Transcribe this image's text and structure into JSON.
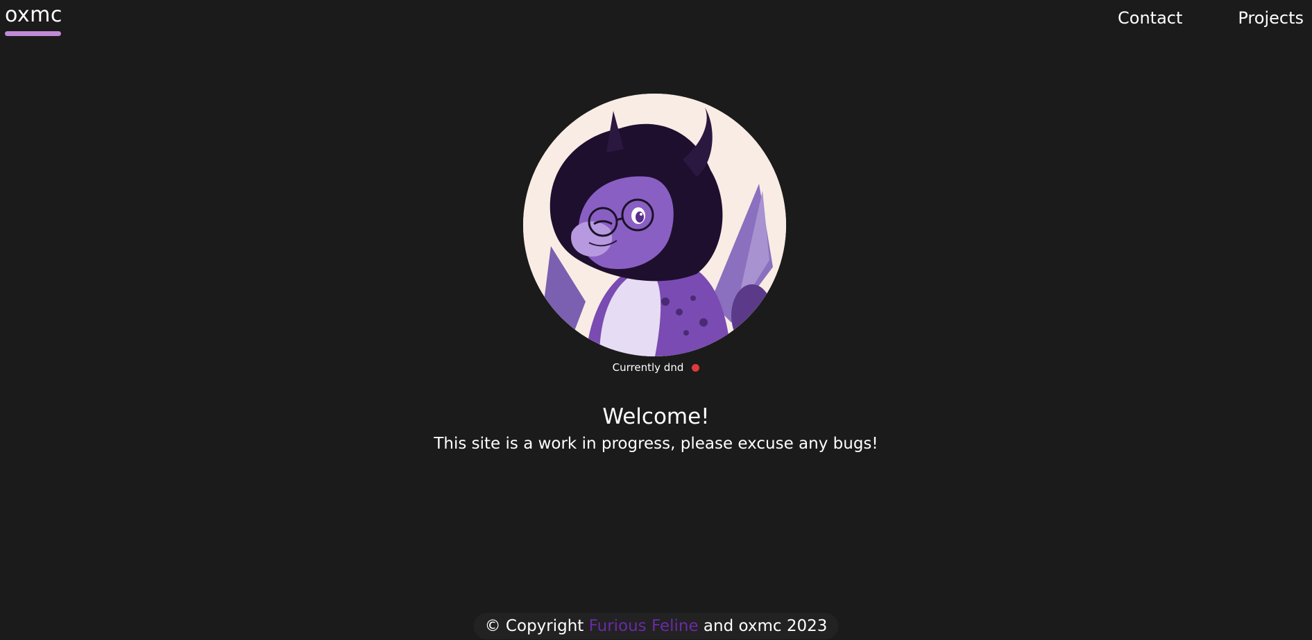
{
  "header": {
    "logo": "oxmc",
    "nav": [
      {
        "label": "Contact"
      },
      {
        "label": "Projects"
      }
    ]
  },
  "avatar": {
    "status_text": "Currently dnd",
    "status_color": "#e0393e"
  },
  "welcome": {
    "title": "Welcome!",
    "subtitle": "This site is a work in progress, please excuse any bugs!"
  },
  "footer": {
    "prefix": "© Copyright",
    "link_text": "Furious Feline",
    "suffix": "and oxmc 2023",
    "link_color": "#6a2aa8"
  },
  "colors": {
    "background": "#1b1b1b",
    "accent": "#c08ad6"
  }
}
